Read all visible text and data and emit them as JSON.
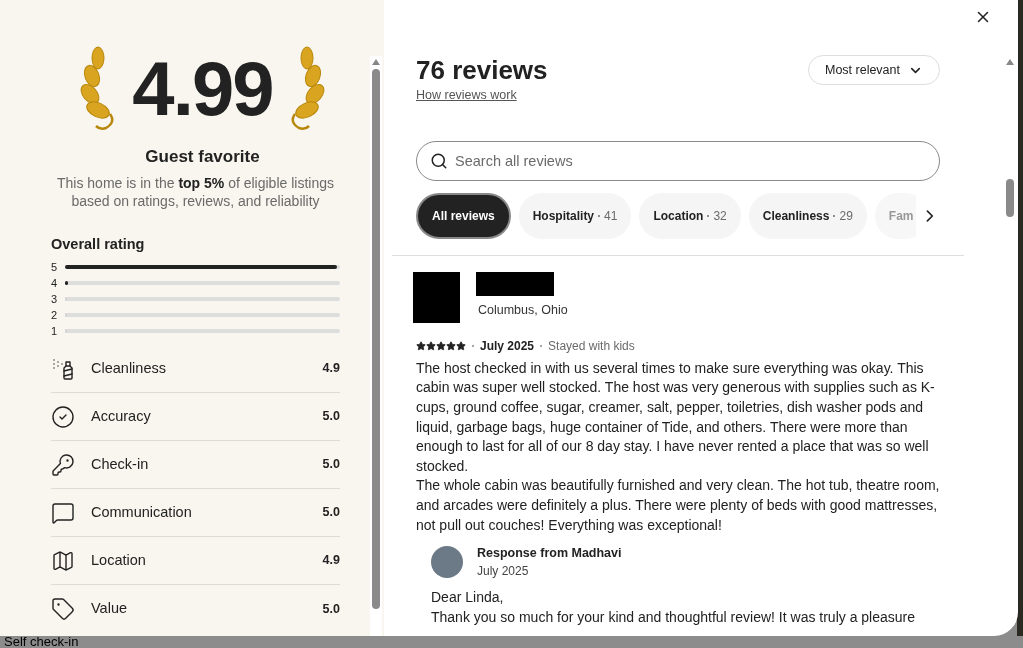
{
  "summary": {
    "score": "4.99",
    "badge": "Guest favorite",
    "description": "This home is in the **top 5%** of eligible listings based on ratings, reviews, and reliability"
  },
  "overall": {
    "title": "Overall rating",
    "bars": [
      {
        "label": "5",
        "level": 0.99
      },
      {
        "label": "4",
        "level": 0.01
      },
      {
        "label": "3",
        "level": 0
      },
      {
        "label": "2",
        "level": 0
      },
      {
        "label": "1",
        "level": 0
      }
    ]
  },
  "categories": [
    {
      "kind": "spray",
      "label": "Cleanliness",
      "score": "4.9"
    },
    {
      "kind": "check",
      "label": "Accuracy",
      "score": "5.0"
    },
    {
      "kind": "key",
      "label": "Check-in",
      "score": "5.0"
    },
    {
      "kind": "chat",
      "label": "Communication",
      "score": "5.0"
    },
    {
      "kind": "map",
      "label": "Location",
      "score": "4.9"
    },
    {
      "kind": "tag",
      "label": "Value",
      "score": "5.0"
    }
  ],
  "reviews_panel": {
    "title": "76 reviews",
    "link": "How reviews work",
    "sort": "Most relevant",
    "search": {
      "placeholder": "Search all reviews"
    },
    "filters": [
      {
        "label": "All reviews",
        "selected": true
      },
      {
        "label": "Hospitality",
        "count": "41",
        "selected": false
      },
      {
        "label": "Location",
        "count": "32",
        "selected": false
      },
      {
        "label": "Cleanliness",
        "count": "29",
        "selected": false
      },
      {
        "label": "Fam",
        "selected": false
      }
    ]
  },
  "review": {
    "location": "Columbus, Ohio",
    "stars": 5,
    "date": "July 2025",
    "trip": "Stayed with kids",
    "paragraphs": [
      "The host checked in with us several times to make sure everything was okay. This cabin was super well stocked. The host was very generous with supplies such as K-cups, ground coffee, sugar, creamer, salt, pepper, toiletries, dish washer pods and liquid, garbage bags, huge container of Tide, and others. There were more than enough to last for all of our 8 day stay. I have never rented a place that was so well stocked.",
      "The whole cabin was beautifully furnished and very clean. The hot tub, theatre room, and arcades were definitely a plus. There were plenty of beds with good mattresses, not pull out couches! Everything was exceptional!"
    ],
    "response": {
      "title": "Response from Madhavi",
      "date": "July 2025",
      "paragraphs": [
        "Dear Linda,",
        "Thank you so much for your kind and thoughtful review! It was truly a pleasure"
      ]
    }
  },
  "background": {
    "text": "Self check-in"
  }
}
